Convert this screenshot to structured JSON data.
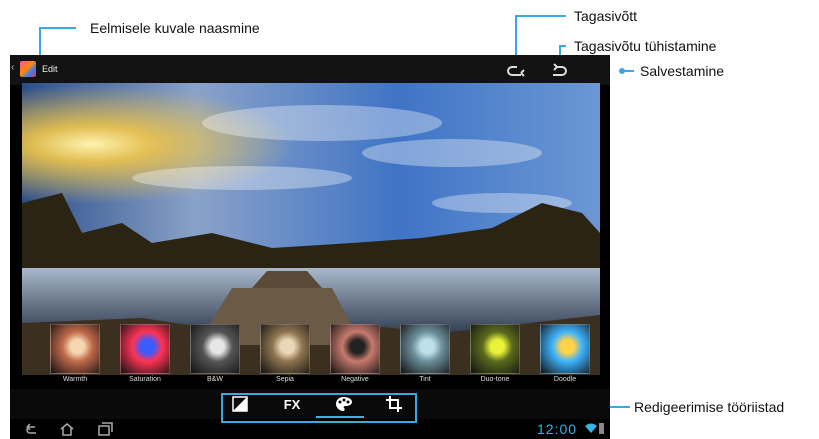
{
  "callouts": {
    "previous_image": "Eelmisele kuvale naasmine",
    "undo": "Tagasivõtt",
    "redo": "Tagasivõtu tühistamine",
    "save": "Salvestamine",
    "tools": "Redigeerimise tööriistad"
  },
  "actionbar": {
    "title": "Edit",
    "icons": [
      "back-caret",
      "gallery-app-icon",
      "undo-icon",
      "redo-icon"
    ]
  },
  "filters": [
    {
      "label": "Warmth"
    },
    {
      "label": "Saturation"
    },
    {
      "label": "B&W"
    },
    {
      "label": "Sepia"
    },
    {
      "label": "Negative"
    },
    {
      "label": "Tint"
    },
    {
      "label": "Duo-tone"
    },
    {
      "label": "Doodle"
    }
  ],
  "toolbar": {
    "fx_label": "FX",
    "active_tab": "color-effects",
    "icons": [
      "exposure-icon",
      "fx-effects",
      "palette-icon",
      "crop-icon"
    ]
  },
  "statusbar": {
    "time": "12:00"
  },
  "colors": {
    "accent": "#33b5e5",
    "callout_line": "#3aa7e6"
  }
}
